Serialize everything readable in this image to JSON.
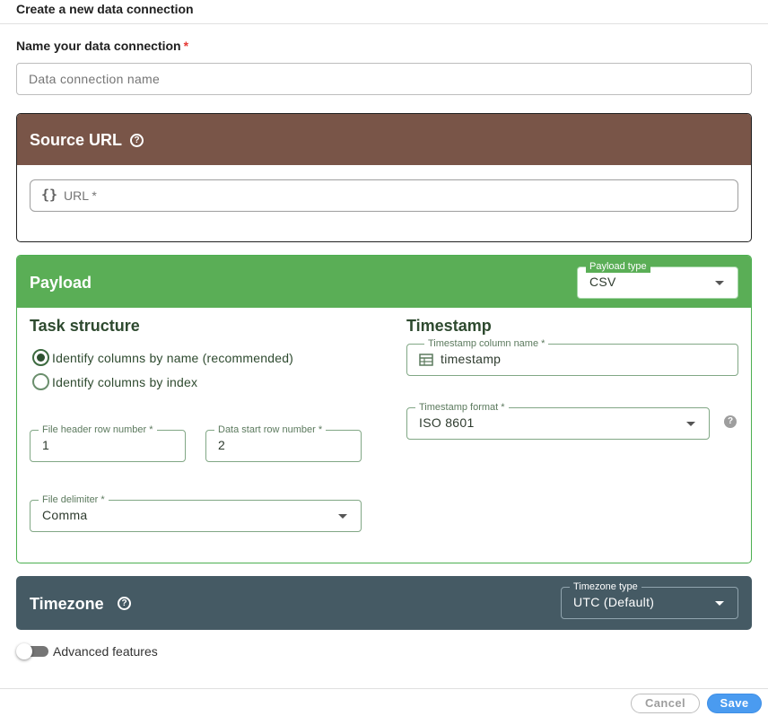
{
  "dialog": {
    "title": "Create a new data connection"
  },
  "name": {
    "label": "Name your data connection",
    "required_mark": "*",
    "placeholder": "Data connection name"
  },
  "source": {
    "title": "Source URL",
    "help_icon": "help-circle-icon",
    "url_icon_glyph": "{}",
    "url_label": "URL *"
  },
  "payload": {
    "title": "Payload",
    "type_label": "Payload type",
    "type_value": "CSV",
    "task_structure": {
      "title": "Task structure",
      "options": [
        {
          "label": "Identify columns by name (recommended)",
          "selected": true
        },
        {
          "label": "Identify columns by index",
          "selected": false
        }
      ],
      "header_row": {
        "label": "File header row number *",
        "value": "1"
      },
      "data_start_row": {
        "label": "Data start row number *",
        "value": "2"
      },
      "delimiter": {
        "label": "File delimiter *",
        "value": "Comma"
      }
    },
    "timestamp": {
      "title": "Timestamp",
      "column": {
        "label": "Timestamp column name *",
        "value": "timestamp"
      },
      "format": {
        "label": "Timestamp format *",
        "value": "ISO 8601",
        "help_glyph": "?"
      }
    }
  },
  "timezone": {
    "title": "Timezone",
    "type_label": "Timezone type",
    "type_value": "UTC (Default)"
  },
  "advanced": {
    "label": "Advanced features",
    "enabled": false
  },
  "footer": {
    "cancel_label": "Cancel",
    "save_label": "Save"
  },
  "colors": {
    "source_header": "#795548",
    "payload_header": "#5aae56",
    "timezone_header": "#455a64",
    "save_button": "#4a9bf0",
    "required": "#e53935"
  }
}
